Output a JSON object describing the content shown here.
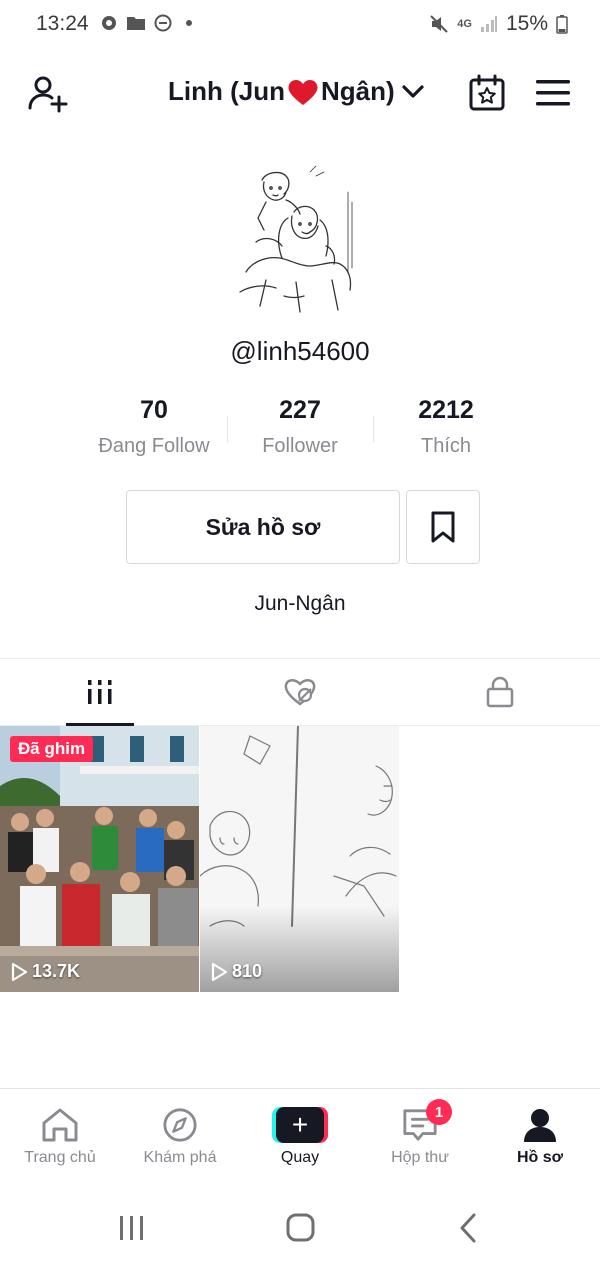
{
  "status_bar": {
    "time": "13:24",
    "network": "4G",
    "battery": "15%"
  },
  "header": {
    "title_prefix": "Linh (Jun",
    "title_suffix": "Ngân)"
  },
  "profile": {
    "username": "@linh54600",
    "bio": "Jun-Ngân",
    "stats": [
      {
        "value": "70",
        "label": "Đang Follow"
      },
      {
        "value": "227",
        "label": "Follower"
      },
      {
        "value": "2212",
        "label": "Thích"
      }
    ],
    "edit_button": "Sửa hồ sơ"
  },
  "videos": [
    {
      "pinned_label": "Đã ghim",
      "views": "13.7K"
    },
    {
      "views": "810"
    }
  ],
  "bottom_nav": {
    "items": [
      {
        "label": "Trang chủ"
      },
      {
        "label": "Khám phá"
      },
      {
        "label": "Quay"
      },
      {
        "label": "Hộp thư",
        "badge": "1"
      },
      {
        "label": "Hồ sơ"
      }
    ]
  },
  "colors": {
    "accent": "#fe2c55",
    "cyan": "#25f4ee",
    "text_primary": "#161823",
    "text_secondary": "#8a8b91"
  },
  "icons": [
    "add-user-icon",
    "chevron-down-icon",
    "calendar-star-icon",
    "menu-icon",
    "bookmark-icon",
    "grid-icon",
    "liked-hidden-icon",
    "lock-icon",
    "play-icon",
    "home-icon",
    "compass-icon",
    "plus-icon",
    "inbox-icon",
    "profile-icon",
    "recents-icon",
    "home-button-icon",
    "back-icon"
  ]
}
